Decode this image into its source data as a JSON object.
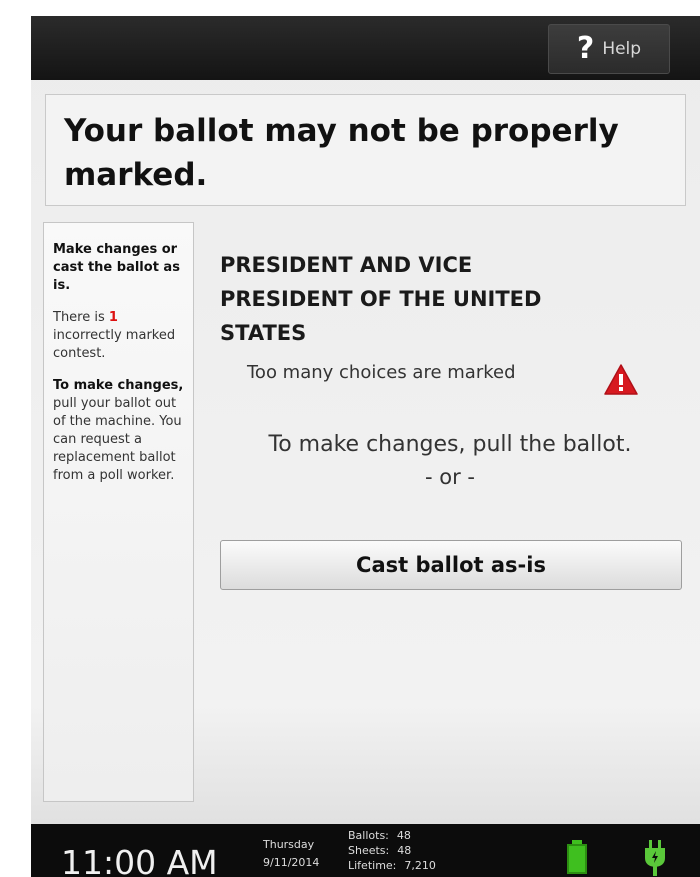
{
  "help": {
    "icon": "question-mark-icon",
    "label": "Help"
  },
  "alert": {
    "title_line1": "Your ballot may not be properly",
    "title_line2": "marked."
  },
  "sidebar": {
    "heading": "Make changes or cast the ballot as is.",
    "count_prefix": "There is ",
    "count_value": "1",
    "count_suffix": " incorrectly marked contest.",
    "changes_bold": "To make changes,",
    "changes_text": " pull your ballot out of the machine. You can request a replacement ballot from a poll worker."
  },
  "contest": {
    "line1": "PRESIDENT AND VICE",
    "line2": "PRESIDENT OF THE UNITED",
    "line3": "STATES",
    "warning": "Too many choices are marked",
    "warning_icon": "warning-triangle-icon"
  },
  "instructions": {
    "line": "To make changes, pull the ballot.",
    "or": "- or -"
  },
  "cast_button": {
    "label": "Cast ballot as-is"
  },
  "status": {
    "time": "11:00 AM",
    "day": "Thursday",
    "date": "9/11/2014",
    "ballots_label": "Ballots:",
    "ballots": "48",
    "sheets_label": "Sheets:",
    "sheets": "48",
    "lifetime_label": "Lifetime:",
    "lifetime": "7,210",
    "battery_icon": "battery-icon",
    "power_icon": "power-plug-icon"
  },
  "colors": {
    "topbar": "#1c1c1c",
    "accent_red": "#d11111",
    "battery_green": "#3fbf1f"
  }
}
